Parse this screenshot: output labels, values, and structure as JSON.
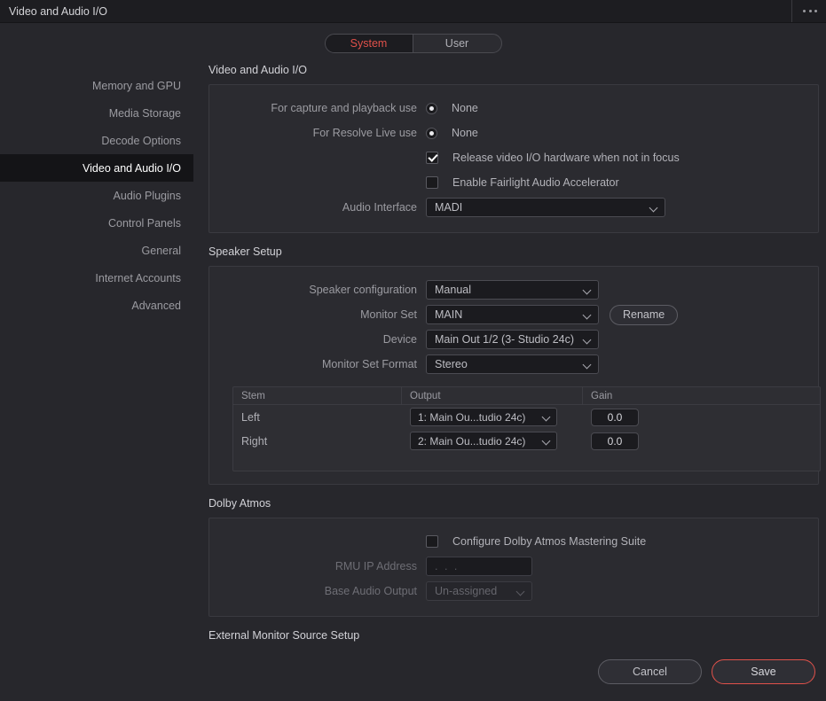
{
  "window": {
    "title": "Video and Audio I/O",
    "menu_icon": "more-horizontal-icon"
  },
  "tabs": {
    "items": [
      {
        "label": "System",
        "active": true
      },
      {
        "label": "User",
        "active": false
      }
    ],
    "active_color": "#e0514a"
  },
  "sidebar": {
    "items": [
      {
        "label": "Memory and GPU",
        "active": false
      },
      {
        "label": "Media Storage",
        "active": false
      },
      {
        "label": "Decode Options",
        "active": false
      },
      {
        "label": "Video and Audio I/O",
        "active": true
      },
      {
        "label": "Audio Plugins",
        "active": false
      },
      {
        "label": "Control Panels",
        "active": false
      },
      {
        "label": "General",
        "active": false
      },
      {
        "label": "Internet Accounts",
        "active": false
      },
      {
        "label": "Advanced",
        "active": false
      }
    ]
  },
  "sections": {
    "video_audio_io": {
      "title": "Video and Audio I/O",
      "capture_playback": {
        "label": "For capture and playback use",
        "value": "None",
        "selected": true
      },
      "resolve_live": {
        "label": "For Resolve Live use",
        "value": "None",
        "selected": true
      },
      "release_hardware": {
        "label": "Release video I/O hardware when not in focus",
        "checked": true
      },
      "fairlight_accelerator": {
        "label": "Enable Fairlight Audio Accelerator",
        "checked": false
      },
      "audio_interface": {
        "label": "Audio Interface",
        "value": "MADI"
      }
    },
    "speaker_setup": {
      "title": "Speaker Setup",
      "speaker_configuration": {
        "label": "Speaker configuration",
        "value": "Manual"
      },
      "monitor_set": {
        "label": "Monitor Set",
        "value": "MAIN"
      },
      "rename_button": "Rename",
      "device": {
        "label": "Device",
        "value": "Main Out 1/2 (3- Studio 24c)"
      },
      "monitor_set_format": {
        "label": "Monitor Set Format",
        "value": "Stereo"
      },
      "table": {
        "columns": [
          "Stem",
          "Output",
          "Gain"
        ],
        "rows": [
          {
            "stem": "Left",
            "output": "1: Main Ou...tudio 24c)",
            "gain": "0.0"
          },
          {
            "stem": "Right",
            "output": "2: Main Ou...tudio 24c)",
            "gain": "0.0"
          }
        ]
      }
    },
    "dolby_atmos": {
      "title": "Dolby Atmos",
      "configure": {
        "label": "Configure Dolby Atmos Mastering Suite",
        "checked": false
      },
      "rmu_ip": {
        "label": "RMU IP Address",
        "value": ". . .",
        "disabled": true
      },
      "base_audio_output": {
        "label": "Base Audio Output",
        "value": "Un-assigned",
        "disabled": true
      }
    },
    "external_monitor": {
      "title": "External Monitor Source Setup"
    }
  },
  "footer": {
    "cancel_label": "Cancel",
    "save_label": "Save"
  }
}
